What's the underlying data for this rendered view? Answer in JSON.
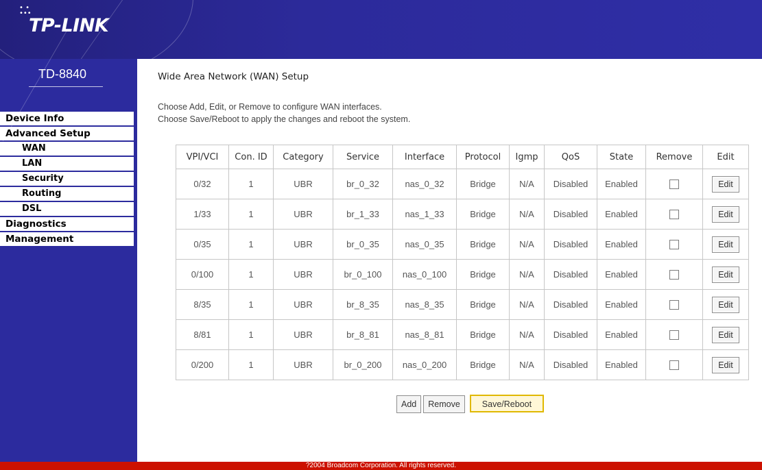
{
  "brand": {
    "logo": "TP-LINK",
    "model": "TD-8840"
  },
  "menu": [
    {
      "label": "Device Info",
      "sub": false
    },
    {
      "label": "Advanced Setup",
      "sub": false
    },
    {
      "label": "WAN",
      "sub": true
    },
    {
      "label": "LAN",
      "sub": true
    },
    {
      "label": "Security",
      "sub": true
    },
    {
      "label": "Routing",
      "sub": true
    },
    {
      "label": "DSL",
      "sub": true
    },
    {
      "label": "Diagnostics",
      "sub": false
    },
    {
      "label": "Management",
      "sub": false
    }
  ],
  "page": {
    "title": "Wide Area Network (WAN) Setup",
    "desc1": "Choose Add, Edit, or Remove to configure WAN interfaces.",
    "desc2": "Choose Save/Reboot to apply the changes and reboot the system."
  },
  "table": {
    "headers": [
      "VPI/VCI",
      "Con. ID",
      "Category",
      "Service",
      "Interface",
      "Protocol",
      "Igmp",
      "QoS",
      "State",
      "Remove",
      "Edit"
    ],
    "rows": [
      {
        "vpivci": "0/32",
        "conid": "1",
        "category": "UBR",
        "service": "br_0_32",
        "interface": "nas_0_32",
        "protocol": "Bridge",
        "igmp": "N/A",
        "qos": "Disabled",
        "state": "Enabled",
        "edit": "Edit"
      },
      {
        "vpivci": "1/33",
        "conid": "1",
        "category": "UBR",
        "service": "br_1_33",
        "interface": "nas_1_33",
        "protocol": "Bridge",
        "igmp": "N/A",
        "qos": "Disabled",
        "state": "Enabled",
        "edit": "Edit"
      },
      {
        "vpivci": "0/35",
        "conid": "1",
        "category": "UBR",
        "service": "br_0_35",
        "interface": "nas_0_35",
        "protocol": "Bridge",
        "igmp": "N/A",
        "qos": "Disabled",
        "state": "Enabled",
        "edit": "Edit"
      },
      {
        "vpivci": "0/100",
        "conid": "1",
        "category": "UBR",
        "service": "br_0_100",
        "interface": "nas_0_100",
        "protocol": "Bridge",
        "igmp": "N/A",
        "qos": "Disabled",
        "state": "Enabled",
        "edit": "Edit"
      },
      {
        "vpivci": "8/35",
        "conid": "1",
        "category": "UBR",
        "service": "br_8_35",
        "interface": "nas_8_35",
        "protocol": "Bridge",
        "igmp": "N/A",
        "qos": "Disabled",
        "state": "Enabled",
        "edit": "Edit"
      },
      {
        "vpivci": "8/81",
        "conid": "1",
        "category": "UBR",
        "service": "br_8_81",
        "interface": "nas_8_81",
        "protocol": "Bridge",
        "igmp": "N/A",
        "qos": "Disabled",
        "state": "Enabled",
        "edit": "Edit"
      },
      {
        "vpivci": "0/200",
        "conid": "1",
        "category": "UBR",
        "service": "br_0_200",
        "interface": "nas_0_200",
        "protocol": "Bridge",
        "igmp": "N/A",
        "qos": "Disabled",
        "state": "Enabled",
        "edit": "Edit"
      }
    ]
  },
  "actions": {
    "add": "Add",
    "remove": "Remove",
    "save": "Save/Reboot"
  },
  "footer": "?2004 Broadcom Corporation. All rights reserved.",
  "colors": {
    "nav_blue": "#2c2b9e",
    "footer_red": "#cc1100",
    "save_border": "#e0b800"
  }
}
